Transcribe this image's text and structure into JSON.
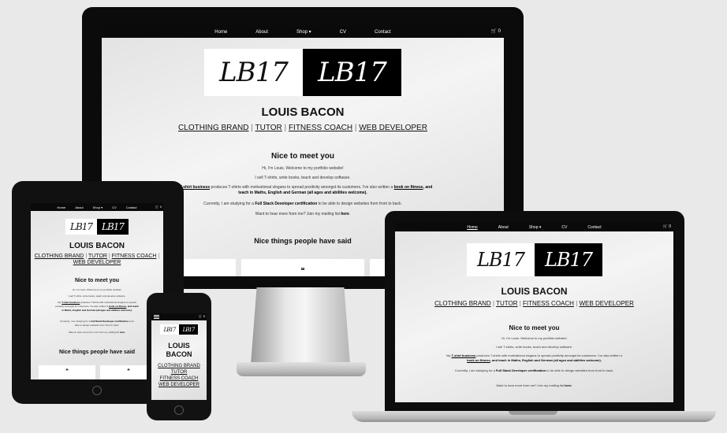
{
  "site": {
    "nav": [
      "Home",
      "About",
      "Shop",
      "CV",
      "Contact"
    ],
    "shop_caret": "▾",
    "cart": "🛒 0",
    "logo": "LB17",
    "name": "LOUIS BACON",
    "name_line1": "LOUIS",
    "name_line2": "BACON",
    "roles": [
      "CLOTHING BRAND",
      "TUTOR",
      "FITNESS COACH",
      "WEB DEVELOPER"
    ],
    "role_separator": "|",
    "section_title": "Nice to meet you",
    "intro": {
      "greeting": "Hi, I'm Louis. Welcome to my portfolio website!",
      "do_line": "I sell T-shirts, write books, teach and develop software.",
      "p3_pre": "My",
      "p3_link1": "T-shirt business",
      "p3_mid": "produces T-shirts with motivational slogans to spread positivity amongst its customers. I've also written a",
      "p3_link2": "book on fitness",
      "p3_post": ", and teach in Maths, English and German (all ages and abilities welcome).",
      "p4_pre": "Currently, I am studying for a",
      "p4_link": "Full Stack Developer certification",
      "p4_post": "to be able to design websites from front to back.",
      "p5_pre": "Want to hear more from me? Join my mailing list",
      "p5_link": "here",
      "p5_post": "."
    },
    "testimonials_title": "Nice things people have said",
    "quote_mark": "❝"
  },
  "colors": {
    "nav_bg": "#0a0a0a",
    "nav_text": "#ffffff",
    "page_bg": "#e9e9e9"
  }
}
